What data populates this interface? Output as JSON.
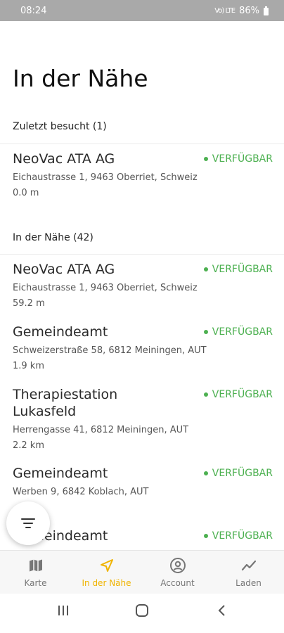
{
  "status_bar": {
    "time": "08:24",
    "signal": "Vo) LTE",
    "battery": "86%"
  },
  "page": {
    "title": "In der Nähe"
  },
  "sections": [
    {
      "header": "Zuletzt besucht (1)",
      "stations": [
        {
          "name": "NeoVac ATA AG",
          "address": "Eichaustrasse 1, 9463 Oberriet, Schweiz",
          "distance": "0.0 m",
          "status": "VERFÜGBAR"
        }
      ]
    },
    {
      "header": "In der Nähe (42)",
      "stations": [
        {
          "name": "NeoVac ATA AG",
          "address": "Eichaustrasse 1, 9463 Oberriet, Schweiz",
          "distance": "59.2 m",
          "status": "VERFÜGBAR"
        },
        {
          "name": "Gemeindeamt",
          "address": "Schweizerstraße 58, 6812 Meiningen, AUT",
          "distance": "1.9 km",
          "status": "VERFÜGBAR"
        },
        {
          "name": "Therapiestation Lukasfeld",
          "address": "Herrengasse 41, 6812 Meiningen, AUT",
          "distance": "2.2 km",
          "status": "VERFÜGBAR"
        },
        {
          "name": "Gemeindeamt",
          "address": "Werben 9, 6842 Koblach, AUT",
          "distance": "",
          "status": "VERFÜGBAR"
        },
        {
          "name": "Gemeindeamt",
          "address": "",
          "distance": "",
          "status": "VERFÜGBAR"
        }
      ]
    }
  ],
  "fab": {
    "icon": "filter-icon"
  },
  "bottom_nav": [
    {
      "label": "Karte",
      "icon": "map-icon",
      "active": false
    },
    {
      "label": "In der Nähe",
      "icon": "navigation-arrow-icon",
      "active": true
    },
    {
      "label": "Account",
      "icon": "account-circle-icon",
      "active": false
    },
    {
      "label": "Laden",
      "icon": "chart-line-icon",
      "active": false
    }
  ],
  "colors": {
    "accent": "#f0b400",
    "available": "#4cb050",
    "status_bar": "#a9a9a9"
  }
}
